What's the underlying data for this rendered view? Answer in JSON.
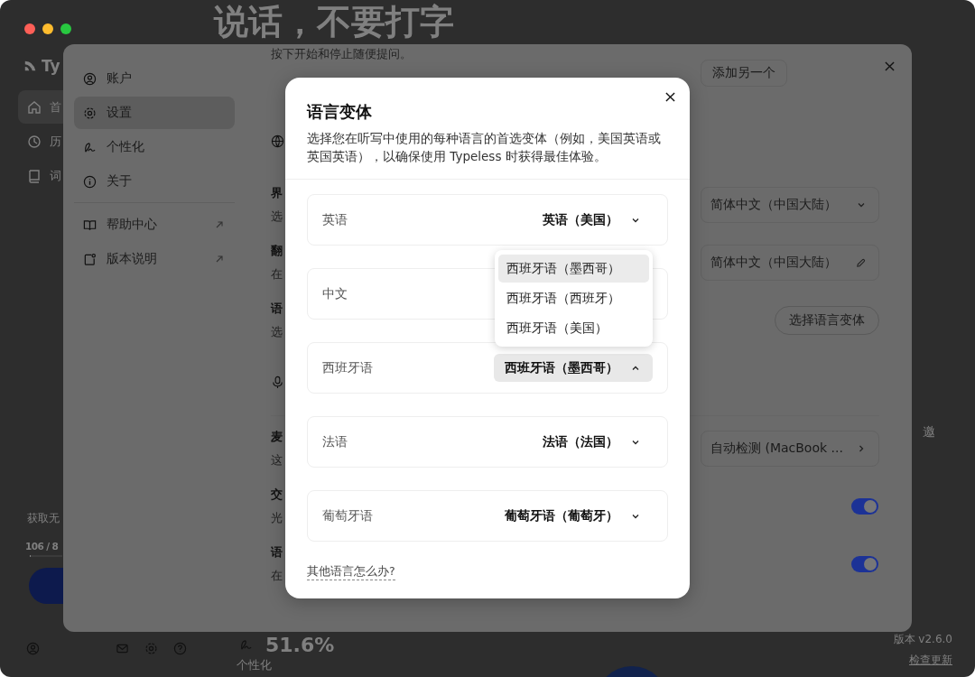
{
  "app": {
    "logo": "Ty",
    "nav": [
      {
        "label": "首",
        "selected": true
      },
      {
        "label": "历",
        "selected": false
      },
      {
        "label": "词",
        "selected": false
      }
    ],
    "headline": "说话，不要打字",
    "quota_label": "获取无",
    "quota": "106 / 8",
    "quota_progress": {
      "level": 0.02
    },
    "stat": "51.6%",
    "stat_label": "个性化",
    "side_note": "邀",
    "version": "版本 v2.6.0",
    "update_link": "检查更新"
  },
  "settings": {
    "nav": [
      {
        "label": "账户",
        "selected": false,
        "external": false
      },
      {
        "label": "设置",
        "selected": true,
        "external": false
      },
      {
        "label": "个性化",
        "selected": false,
        "external": false
      },
      {
        "label": "关于",
        "selected": false,
        "external": false
      }
    ],
    "links": [
      {
        "label": "帮助中心",
        "external": true
      },
      {
        "label": "版本说明",
        "external": true
      }
    ],
    "subtitle": "按下开始和停止随便提问。",
    "add_button": "添加另一个",
    "rows": [
      {
        "kind": "select",
        "title": "界",
        "desc": "选",
        "value": "简体中文（中国大陆）"
      },
      {
        "kind": "edit",
        "title": "翻",
        "desc": "在",
        "value": "简体中文（中国大陆）"
      },
      {
        "kind": "button",
        "title": "语",
        "desc": "选",
        "value": "选择语言变体"
      },
      {
        "kind": "divider"
      },
      {
        "kind": "device",
        "title": "麦",
        "desc": "这",
        "value": "自动检测 (MacBook ..."
      },
      {
        "kind": "toggle",
        "title": "交",
        "desc": "光",
        "on": true
      },
      {
        "kind": "toggle",
        "title": "语",
        "desc": "在",
        "on": true
      }
    ]
  },
  "dialog": {
    "title": "语言变体",
    "description": "选择您在听写中使用的每种语言的首选变体（例如，美国英语或英国英语），以确保使用 Typeless 时获得最佳体验。",
    "languages": [
      {
        "label": "英语",
        "value": "英语（美国）",
        "expanded": false
      },
      {
        "label": "中文"
      },
      {
        "label": "西班牙语",
        "value": "西班牙语（墨西哥）",
        "expanded": true,
        "options": [
          {
            "label": "西班牙语（墨西哥）",
            "selected": true
          },
          {
            "label": "西班牙语（西班牙）",
            "selected": false
          },
          {
            "label": "西班牙语（美国）",
            "selected": false
          }
        ]
      },
      {
        "label": "法语",
        "value": "法语（法国）",
        "expanded": false
      },
      {
        "label": "葡萄牙语",
        "value": "葡萄牙语（葡萄牙）",
        "expanded": false
      }
    ],
    "link": "其他语言怎么办?"
  }
}
